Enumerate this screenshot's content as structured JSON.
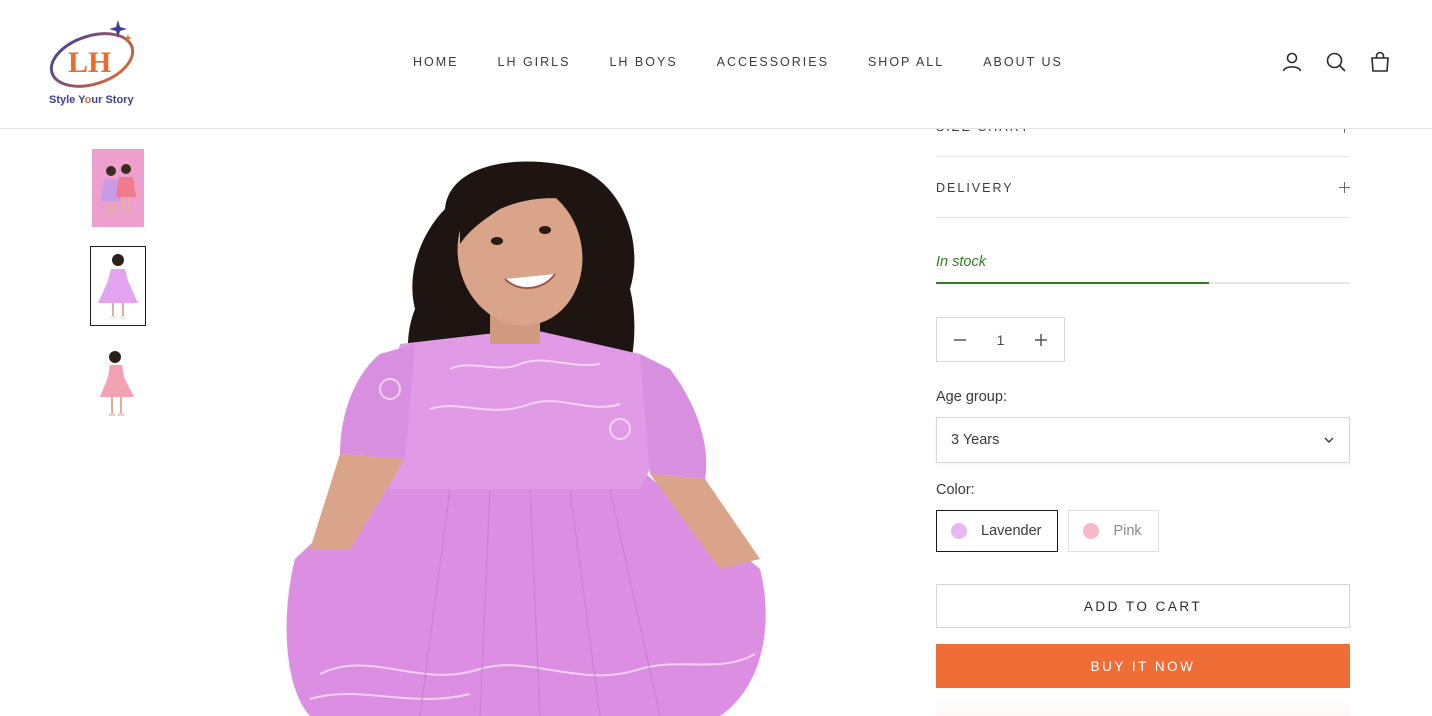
{
  "brand": {
    "logo_letters": "LH",
    "tagline_start": "Style Y",
    "tagline_highlight": "o",
    "tagline_end": "ur Story",
    "colors": {
      "primary": "#3c3f9b",
      "accent": "#ea6b2d"
    }
  },
  "nav": {
    "items": [
      {
        "label": "HOME"
      },
      {
        "label": "LH GIRLS"
      },
      {
        "label": "LH BOYS"
      },
      {
        "label": "ACCESSORIES"
      },
      {
        "label": "SHOP ALL"
      },
      {
        "label": "ABOUT US"
      }
    ]
  },
  "header_icons": [
    "account-icon",
    "search-icon",
    "cart-icon"
  ],
  "gallery": {
    "thumbnails": [
      {
        "name": "thumbnail-two-girls",
        "active": false
      },
      {
        "name": "thumbnail-lavender-dress",
        "active": true
      },
      {
        "name": "thumbnail-pink-dress",
        "active": false
      }
    ]
  },
  "product": {
    "accordions": [
      {
        "label": "SIZE CHART"
      },
      {
        "label": "DELIVERY"
      }
    ],
    "stock": {
      "text": "In stock",
      "level": 0.66,
      "color": "#2e7d1f"
    },
    "quantity": {
      "value": "1"
    },
    "age_group": {
      "label": "Age group:",
      "selected": "3 Years"
    },
    "color": {
      "label": "Color:",
      "options": [
        {
          "label": "Lavender",
          "swatch": "#e8b8f2",
          "selected": true
        },
        {
          "label": "Pink",
          "swatch": "#f5b8c6",
          "selected": false
        }
      ]
    },
    "add_to_cart": "ADD TO CART",
    "buy_now": "BUY IT NOW",
    "buy_now_color": "#ef6d37"
  }
}
